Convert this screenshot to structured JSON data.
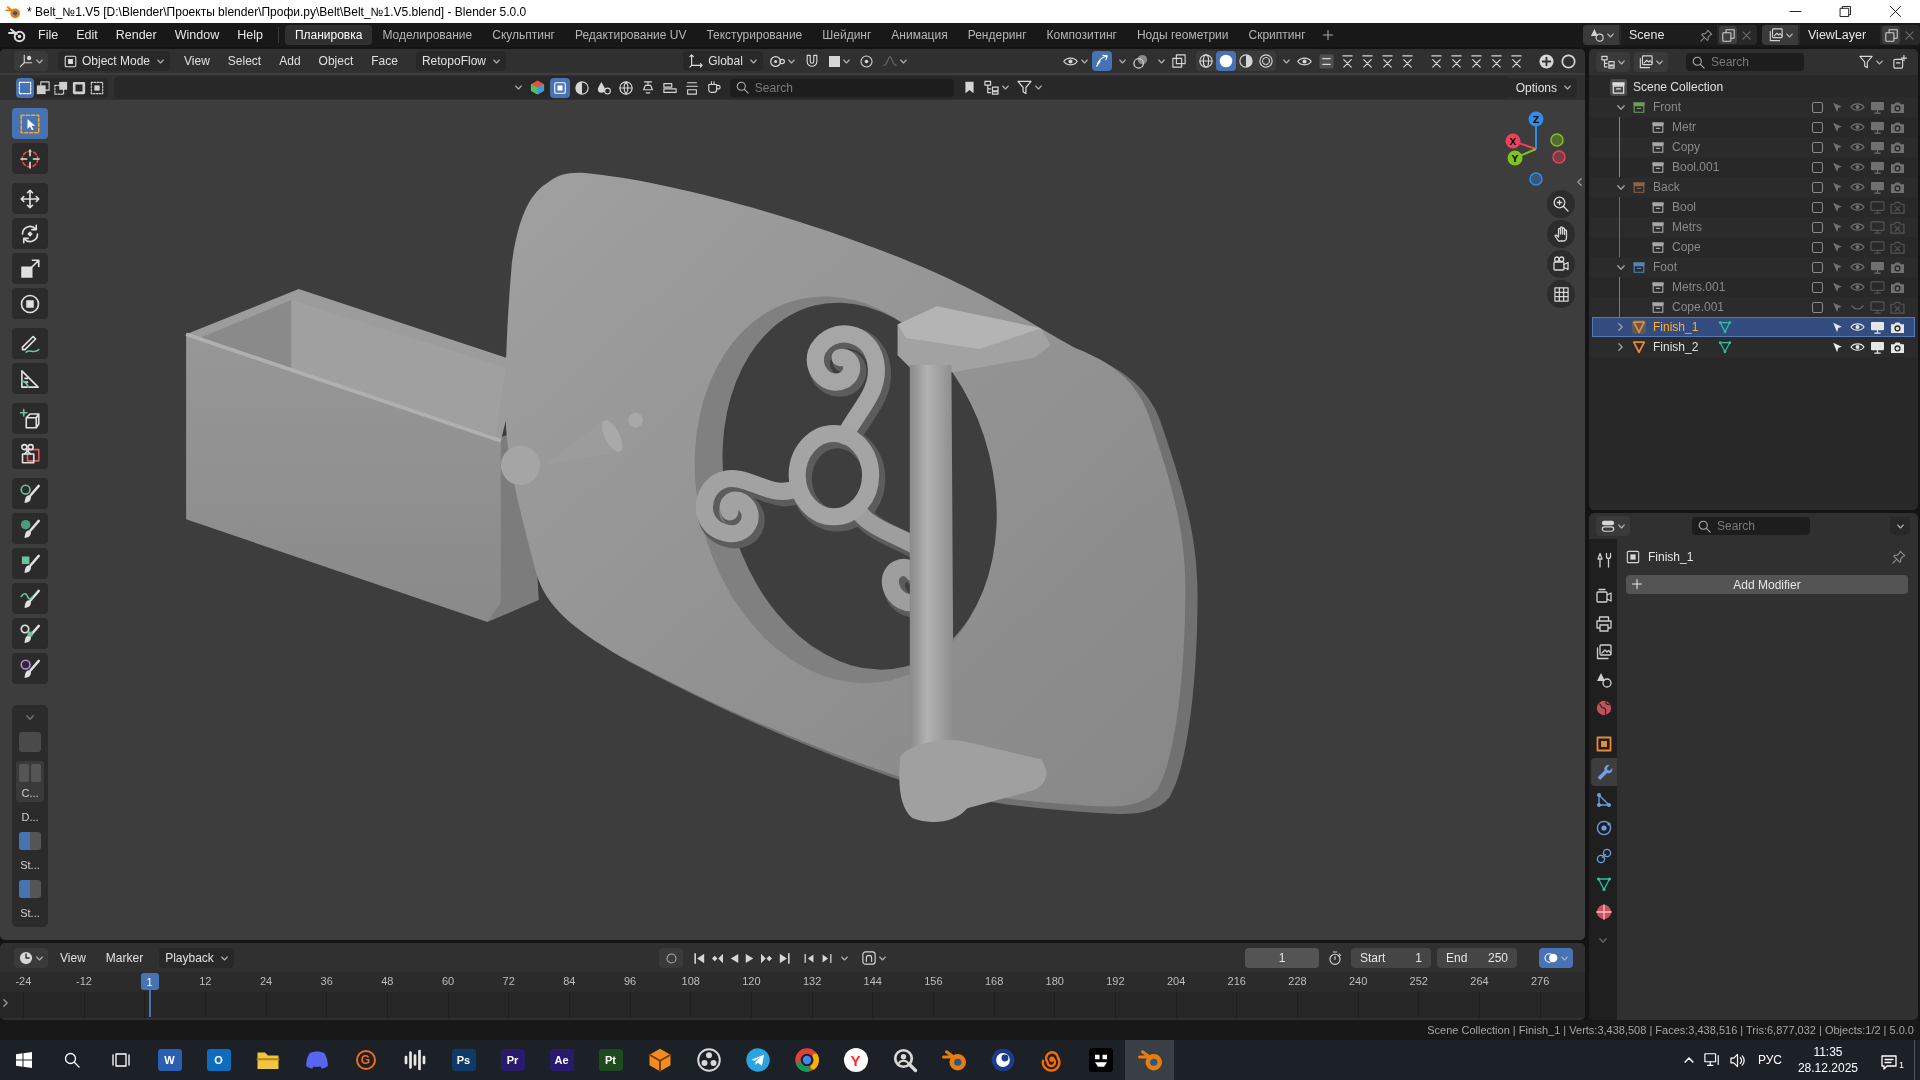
{
  "window": {
    "title": "* Belt_№1.V5 [D:\\Blender\\Проекты blender\\Профи.ру\\Belt\\Belt_№1.V5.blend] - Blender 5.0.0"
  },
  "top_bar": {
    "menus": [
      "File",
      "Edit",
      "Render",
      "Window",
      "Help"
    ],
    "workspaces": [
      {
        "label": "Планировка",
        "selected": true
      },
      {
        "label": "Моделирование",
        "selected": false
      },
      {
        "label": "Скульптинг",
        "selected": false
      },
      {
        "label": "Редактирование UV",
        "selected": false
      },
      {
        "label": "Текстурирование",
        "selected": false
      },
      {
        "label": "Шейдинг",
        "selected": false
      },
      {
        "label": "Анимация",
        "selected": false
      },
      {
        "label": "Рендеринг",
        "selected": false
      },
      {
        "label": "Композитинг",
        "selected": false
      },
      {
        "label": "Ноды геометрии",
        "selected": false
      },
      {
        "label": "Скриптинг",
        "selected": false
      }
    ],
    "scene": "Scene",
    "view_layer": "ViewLayer"
  },
  "viewport": {
    "mode": "Object Mode",
    "menus": [
      "View",
      "Select",
      "Add",
      "Object",
      "Face"
    ],
    "addon_menu": "RetopoFlow",
    "orientation": "Global",
    "gizmos": true,
    "overlays": false,
    "xray": false,
    "shading": [
      {
        "selected": false
      },
      {
        "selected": true
      },
      {
        "selected": false
      },
      {
        "selected": false
      }
    ],
    "select_modes": [
      {
        "selected": true
      },
      {
        "selected": false
      },
      {
        "selected": false
      },
      {
        "selected": false
      },
      {
        "selected": false
      }
    ],
    "filters": [
      {
        "selected": true
      },
      {
        "selected": false
      },
      {
        "selected": false
      },
      {
        "selected": false
      },
      {
        "selected": false
      },
      {
        "selected": false
      },
      {
        "selected": false
      },
      {
        "selected": false
      }
    ],
    "search": {
      "placeholder": "Search"
    },
    "options": "Options",
    "tools": [
      [
        {
          "selected": true
        },
        {
          "selected": false
        }
      ],
      [
        {
          "selected": false
        },
        {
          "selected": false
        },
        {
          "selected": false
        },
        {
          "selected": false
        }
      ],
      [
        {
          "selected": false
        },
        {
          "selected": false
        }
      ],
      [
        {
          "selected": false
        },
        {
          "selected": false
        }
      ],
      [
        {
          "selected": false
        },
        {
          "selected": false
        },
        {
          "selected": false
        },
        {
          "selected": false
        },
        {
          "selected": false
        },
        {
          "selected": false
        }
      ]
    ],
    "tool_settings": [
      {
        "kind": "swatch"
      },
      {
        "kind": "grid",
        "label": "C..."
      },
      {
        "kind": "text",
        "label": "D..."
      },
      {
        "kind": "toggle",
        "on": true
      },
      {
        "kind": "text",
        "label": "St..."
      },
      {
        "kind": "toggle",
        "on": true
      },
      {
        "kind": "text",
        "label": "St..."
      }
    ],
    "axes": [
      {
        "label": "Z",
        "color": "#2f8cf0"
      },
      {
        "label": "X",
        "color": "#f0405a"
      },
      {
        "label": "Y",
        "color": "#7fc41c"
      }
    ]
  },
  "timeline": {
    "menus": [
      "View",
      "Marker"
    ],
    "playback": "Playback",
    "frame": "1",
    "start": {
      "label": "Start",
      "value": "1"
    },
    "end": {
      "label": "End",
      "value": "250"
    },
    "ruler": [
      {
        "kind": "tick",
        "label": "-24"
      },
      {
        "kind": "tick",
        "label": "-12"
      },
      {
        "kind": "playhead",
        "label": "1"
      },
      {
        "kind": "tick",
        "label": "12"
      },
      {
        "kind": "tick",
        "label": "24"
      },
      {
        "kind": "tick",
        "label": "36"
      },
      {
        "kind": "tick",
        "label": "48"
      },
      {
        "kind": "tick",
        "label": "60"
      },
      {
        "kind": "tick",
        "label": "72"
      },
      {
        "kind": "tick",
        "label": "84"
      },
      {
        "kind": "tick",
        "label": "96"
      },
      {
        "kind": "tick",
        "label": "108"
      },
      {
        "kind": "tick",
        "label": "120"
      },
      {
        "kind": "tick",
        "label": "132"
      },
      {
        "kind": "tick",
        "label": "144"
      },
      {
        "kind": "tick",
        "label": "156"
      },
      {
        "kind": "tick",
        "label": "168"
      },
      {
        "kind": "tick",
        "label": "180"
      },
      {
        "kind": "tick",
        "label": "192"
      },
      {
        "kind": "tick",
        "label": "204"
      },
      {
        "kind": "tick",
        "label": "216"
      },
      {
        "kind": "tick",
        "label": "228"
      },
      {
        "kind": "tick",
        "label": "240"
      },
      {
        "kind": "tick",
        "label": "252"
      },
      {
        "kind": "tick",
        "label": "264"
      },
      {
        "kind": "tick",
        "label": "276"
      }
    ]
  },
  "status_bar": {
    "text": "Scene Collection | Finish_1 | Verts:3,438,508 | Faces:3,438,516 | Tris:6,877,032 | Objects:1/2 | 5.0.0"
  },
  "outliner": {
    "search": {
      "placeholder": "Search"
    },
    "root": "Scene Collection",
    "items": [
      {
        "name": "Front",
        "kind": "collection",
        "color": "#6b9e5f",
        "expanded": true,
        "checked": false,
        "selected": false,
        "disabled": true,
        "visible": true,
        "viewport": true,
        "render": true,
        "children": [
          {
            "name": "Metr",
            "kind": "collection",
            "checked": false,
            "selected": false,
            "disabled": true,
            "visible": true,
            "viewport": true,
            "render": true
          },
          {
            "name": "Copy",
            "kind": "collection",
            "checked": false,
            "selected": false,
            "disabled": true,
            "visible": true,
            "viewport": true,
            "render": true
          },
          {
            "name": "Bool.001",
            "kind": "collection",
            "checked": false,
            "selected": false,
            "disabled": true,
            "visible": true,
            "viewport": true,
            "render": true
          }
        ]
      },
      {
        "name": "Back",
        "kind": "collection",
        "color": "#8a6547",
        "expanded": true,
        "checked": false,
        "selected": false,
        "disabled": true,
        "visible": true,
        "viewport": true,
        "render": true,
        "children": [
          {
            "name": "Bool",
            "kind": "collection",
            "checked": false,
            "selected": false,
            "disabled": true,
            "visible": true,
            "viewport": false,
            "render": false
          },
          {
            "name": "Metrs",
            "kind": "collection",
            "checked": false,
            "selected": false,
            "disabled": true,
            "visible": true,
            "viewport": false,
            "render": false
          },
          {
            "name": "Cope",
            "kind": "collection",
            "checked": false,
            "selected": false,
            "disabled": true,
            "visible": true,
            "viewport": false,
            "render": false
          }
        ]
      },
      {
        "name": "Foot",
        "kind": "collection",
        "color": "#4f86b5",
        "expanded": true,
        "checked": false,
        "selected": false,
        "disabled": true,
        "visible": true,
        "viewport": true,
        "render": true,
        "children": [
          {
            "name": "Metrs.001",
            "kind": "collection",
            "checked": false,
            "selected": false,
            "disabled": true,
            "visible": true,
            "viewport": false,
            "render": true
          },
          {
            "name": "Cope.001",
            "kind": "collection",
            "checked": false,
            "selected": false,
            "disabled": true,
            "visible": false,
            "viewport": false,
            "render": false
          }
        ]
      },
      {
        "name": "Finish_1",
        "kind": "object",
        "expanded": false,
        "selected": true,
        "disabled": false,
        "visible": true,
        "viewport": true,
        "render": true
      },
      {
        "name": "Finish_2",
        "kind": "object",
        "expanded": false,
        "selected": false,
        "disabled": false,
        "visible": true,
        "viewport": true,
        "render": true
      }
    ]
  },
  "properties": {
    "search": {
      "placeholder": "Search"
    },
    "tabs": [
      {
        "selected": false
      },
      {
        "selected": false
      },
      {
        "selected": false
      },
      {
        "selected": false
      },
      {
        "selected": false
      },
      {
        "selected": false
      },
      {
        "selected": false
      },
      {
        "selected": true
      },
      {
        "selected": false
      },
      {
        "selected": false
      },
      {
        "selected": false
      },
      {
        "selected": false
      },
      {
        "selected": false
      }
    ],
    "object": "Finish_1",
    "add_modifier": "Add Modifier"
  },
  "taskbar": {
    "apps": [
      {
        "kind": "tile",
        "label": "W",
        "color": "#2b5fb4",
        "selected": false
      },
      {
        "kind": "tile",
        "label": "O",
        "color": "#0f6cbd",
        "selected": false
      },
      {
        "kind": "folder",
        "color": "#f2c443",
        "selected": false
      },
      {
        "kind": "controller",
        "color": "#5865f2",
        "selected": false
      },
      {
        "kind": "ring",
        "label": "G",
        "color": "#f26b1d",
        "selected": false
      },
      {
        "kind": "wave",
        "color": "#e8e8e8",
        "selected": false
      },
      {
        "kind": "tile",
        "label": "Ps",
        "color": "#0d3a66",
        "selected": false
      },
      {
        "kind": "tile",
        "label": "Pr",
        "color": "#2a1a6e",
        "selected": false
      },
      {
        "kind": "tile",
        "label": "Ae",
        "color": "#2a1a6e",
        "selected": false
      },
      {
        "kind": "tile",
        "label": "Pt",
        "color": "#1f4a1f",
        "selected": false
      },
      {
        "kind": "cube",
        "color": "#f08c20",
        "selected": false
      },
      {
        "kind": "dots",
        "color": "#d8d8d8",
        "selected": false
      },
      {
        "kind": "plane",
        "color": "#2aa3e0",
        "selected": false
      },
      {
        "kind": "wheel",
        "color": "#db4437",
        "selected": false
      },
      {
        "kind": "disc",
        "label": "Y",
        "color": "#ff2a2a",
        "selected": false
      },
      {
        "kind": "magnifier",
        "color": "#d8d8d8",
        "selected": false
      },
      {
        "kind": "orbit",
        "color": "#e87d0d",
        "selected": false
      },
      {
        "kind": "sphere",
        "color": "#1d3b8c",
        "selected": false
      },
      {
        "kind": "spiral",
        "color": "#ff6a00",
        "selected": false
      },
      {
        "kind": "dark",
        "color": "#000000",
        "selected": false
      },
      {
        "kind": "orbit",
        "color": "#e87d0d",
        "selected": true
      }
    ],
    "language": "РУС",
    "time": "11:35",
    "date": "28.12.2025",
    "notifications": "1"
  }
}
